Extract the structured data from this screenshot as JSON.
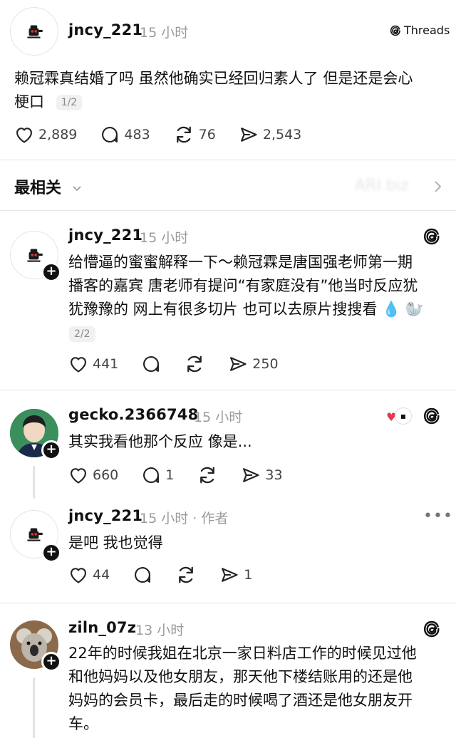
{
  "header": {
    "app_name": "Threads"
  },
  "original_post": {
    "username": "jncy_221",
    "time": "15 小时",
    "text_line1": "赖冠霖真结婚了吗 虽然他确实已经回归素人了 但是还是会心",
    "text_line2": "梗口",
    "page_badge": "1/2",
    "likes": "2,889",
    "comments": "483",
    "reposts": "76",
    "shares": "2,543"
  },
  "sort": {
    "label": "最相关",
    "blurred": "ARI biz"
  },
  "replies": [
    {
      "username": "jncy_221",
      "time": "15 小时",
      "lines": [
        "给懵逼的蜜蜜解释一下～赖冠霖是唐国强老师第一期",
        "播客的嘉宾 唐老师有提问“有家庭没有”他当时反应犹",
        "犹豫豫的 网上有很多切片 也可以去原片搜搜看 💧 🦭"
      ],
      "page_badge": "2/2",
      "likes": "441",
      "comments": "",
      "reposts": "",
      "shares": "250"
    },
    {
      "username": "gecko.2366748",
      "time": "15 小时",
      "lines": [
        "其实我看他那个反应 像是..."
      ],
      "likes": "660",
      "comments": "1",
      "reposts": "",
      "shares": "33"
    },
    {
      "username": "jncy_221",
      "time": "15 小时 · 作者",
      "lines": [
        "是吧 我也觉得"
      ],
      "likes": "44",
      "comments": "",
      "reposts": "",
      "shares": "1"
    },
    {
      "username": "ziln_07z",
      "time": "13 小时",
      "lines": [
        "22年的时候我姐在北京一家日料店工作的时候见过他",
        "和他妈妈以及他女朋友，那天他下楼结账用的还是他",
        "妈妈的会员卡，最后走的时候喝了酒还是他女朋友开",
        "车。"
      ]
    }
  ]
}
